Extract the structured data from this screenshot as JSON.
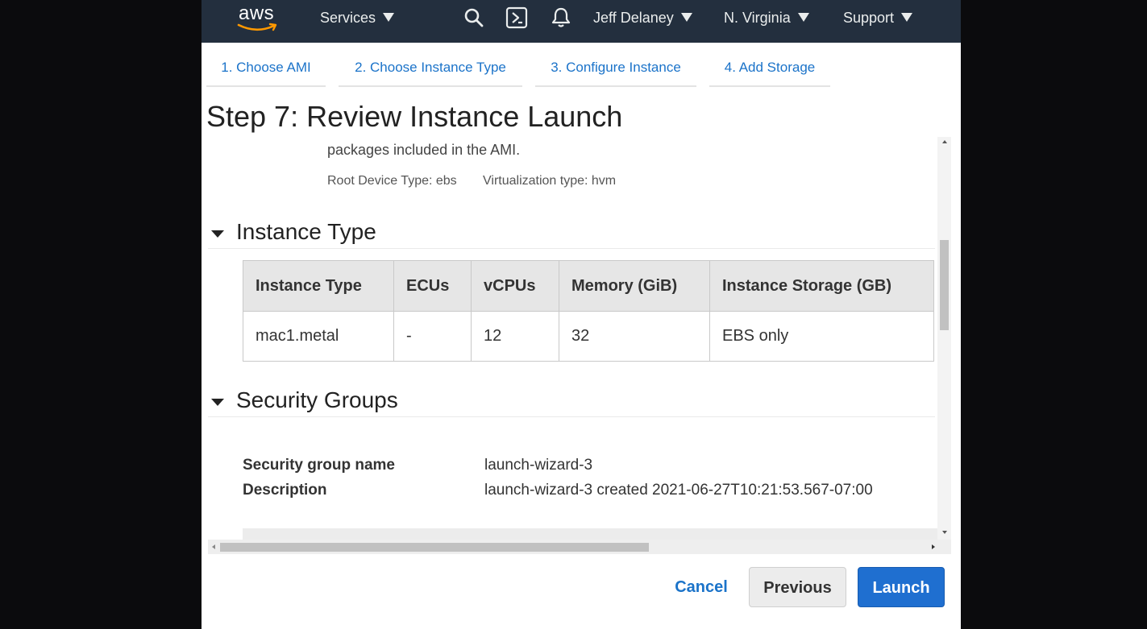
{
  "navbar": {
    "logo_text": "aws",
    "services_label": "Services",
    "user_label": "Jeff Delaney",
    "region_label": "N. Virginia",
    "support_label": "Support",
    "icons": [
      "search-icon",
      "cloudshell-icon",
      "bell-icon"
    ]
  },
  "wizard": {
    "tabs": [
      {
        "label": "1. Choose AMI"
      },
      {
        "label": "2. Choose Instance Type"
      },
      {
        "label": "3. Configure Instance"
      },
      {
        "label": "4. Add Storage"
      }
    ],
    "title": "Step 7: Review Instance Launch"
  },
  "ami": {
    "description_tail": "packages included in the AMI.",
    "root_device": "Root Device Type: ebs",
    "virtualization": "Virtualization type: hvm"
  },
  "instance_type": {
    "section_title": "Instance Type",
    "columns": [
      "Instance Type",
      "ECUs",
      "vCPUs",
      "Memory (GiB)",
      "Instance Storage (GB)"
    ],
    "row": [
      "mac1.metal",
      "-",
      "12",
      "32",
      "EBS only"
    ]
  },
  "security_groups": {
    "section_title": "Security Groups",
    "name_label": "Security group name",
    "name_value": "launch-wizard-3",
    "description_label": "Description",
    "description_value": "launch-wizard-3 created 2021-06-27T10:21:53.567-07:00"
  },
  "footer": {
    "cancel_label": "Cancel",
    "previous_label": "Previous",
    "launch_label": "Launch"
  },
  "colors": {
    "navbar_bg": "#232f3e",
    "link_blue": "#1b73c9",
    "primary_button": "#1f6fd0",
    "aws_smile": "#ff9900"
  }
}
